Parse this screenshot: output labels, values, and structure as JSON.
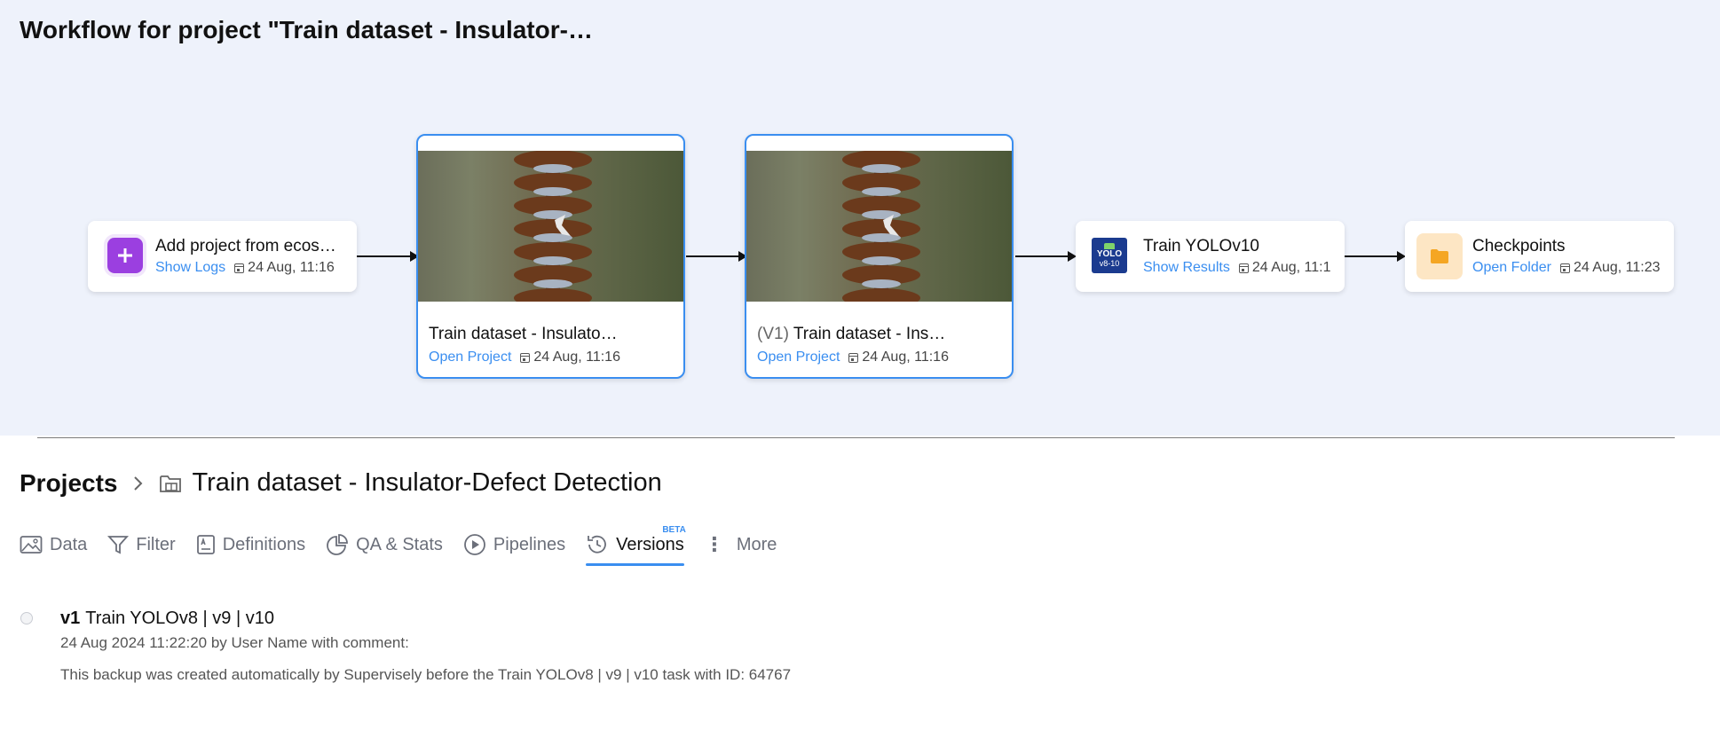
{
  "workflow": {
    "title": "Workflow for project \"Train dataset - Insulator-…",
    "nodes": [
      {
        "title": "Add project from ecos…",
        "link": "Show Logs",
        "date": "24 Aug, 11:16",
        "icon": "plus-icon"
      },
      {
        "title": "Train dataset - Insulato…",
        "link": "Open Project",
        "date": "24 Aug, 11:16",
        "icon": "insulator-image"
      },
      {
        "version": "(V1)",
        "title": "Train dataset - Ins…",
        "link": "Open Project",
        "date": "24 Aug, 11:16",
        "icon": "insulator-image"
      },
      {
        "title": "Train YOLOv10",
        "link": "Show Results",
        "date": "24 Aug, 11:1",
        "icon": "yolo-icon",
        "icon_text_1": "YOLO",
        "icon_text_2": "v8-10"
      },
      {
        "title": "Checkpoints",
        "link": "Open Folder",
        "date": "24 Aug, 11:23",
        "icon": "folder-icon"
      }
    ]
  },
  "breadcrumb": {
    "root": "Projects",
    "current": "Train dataset - Insulator-Defect Detection"
  },
  "tabs": [
    {
      "label": "Data",
      "icon": "image-icon"
    },
    {
      "label": "Filter",
      "icon": "filter-icon"
    },
    {
      "label": "Definitions",
      "icon": "definitions-icon"
    },
    {
      "label": "QA & Stats",
      "icon": "pie-chart-icon"
    },
    {
      "label": "Pipelines",
      "icon": "play-circle-icon"
    },
    {
      "label": "Versions",
      "icon": "history-icon",
      "badge": "BETA",
      "active": true
    },
    {
      "label": "More",
      "icon": "kebab-icon"
    }
  ],
  "version": {
    "tag": "v1",
    "title": "Train YOLOv8 | v9 | v10",
    "meta": "24 Aug 2024 11:22:20 by User Name with comment:",
    "comment": "This backup was created automatically by Supervisely before the Train YOLOv8 | v9 | v10 task with ID: 64767"
  },
  "colors": {
    "accent": "#3a8ef0",
    "workflow_bg": "#eef2fb",
    "plus_icon_bg": "#9b3fe0",
    "folder_icon_bg": "#fde6c4",
    "yolo_icon_bg": "#1b3b8f"
  }
}
